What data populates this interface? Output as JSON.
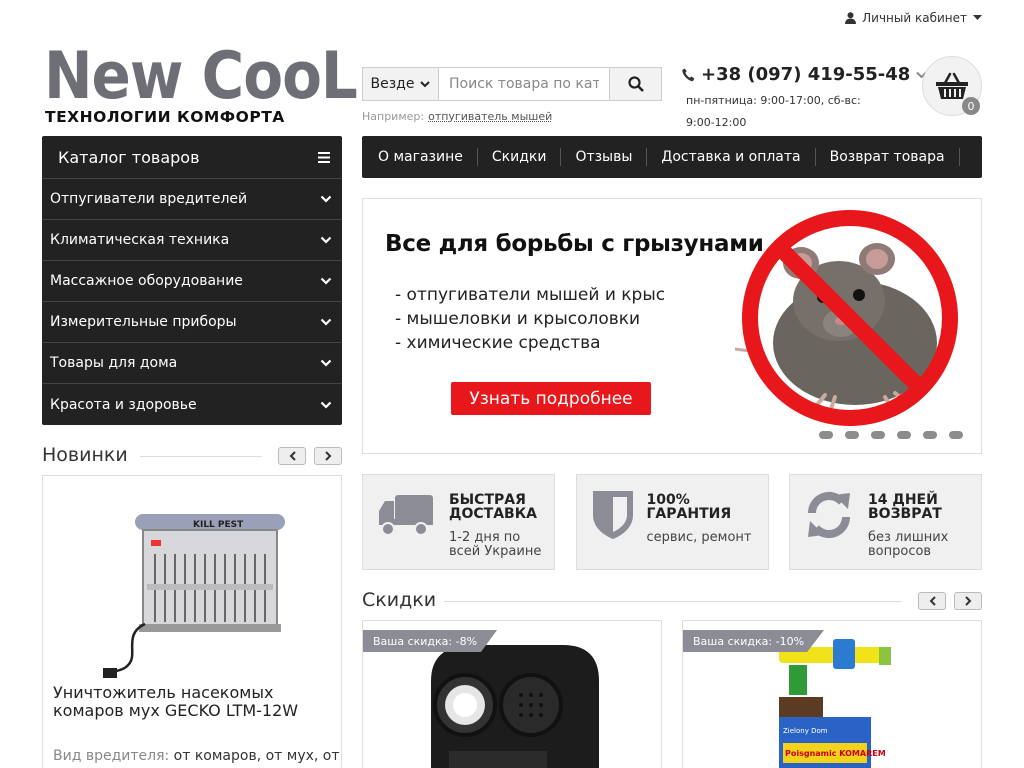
{
  "topbar": {
    "account_label": "Личный кабинет"
  },
  "logo": {
    "main": "New CooL",
    "sub": "ТЕХНОЛОГИИ КОМФОРТА"
  },
  "search": {
    "scope": "Везде",
    "placeholder": "Поиск товара по каталогу",
    "hint_label": "Например:",
    "hint_link": "отпугиватель мышей"
  },
  "contact": {
    "phone": "+38 (097) 419-55-48",
    "hours": "пн-пятница: 9:00-17:00, сб-вс: 9:00-12:00"
  },
  "cart": {
    "count": "0"
  },
  "catalog": {
    "title": "Каталог товаров",
    "items": [
      {
        "label": "Отпугиватели вредителей"
      },
      {
        "label": "Климатическая техника"
      },
      {
        "label": "Массажное оборудование"
      },
      {
        "label": "Измерительные приборы"
      },
      {
        "label": "Товары для дома"
      },
      {
        "label": "Красота и здоровье"
      }
    ]
  },
  "nav": {
    "items": [
      {
        "label": "О магазине"
      },
      {
        "label": "Скидки"
      },
      {
        "label": "Отзывы"
      },
      {
        "label": "Доставка и оплата"
      },
      {
        "label": "Возврат товара"
      }
    ]
  },
  "banner": {
    "title": "Все для борьбы с грызунами",
    "lines": [
      "- отпугиватели мышей и крыс",
      "- мышеловки и крысоловки",
      "- химические средства"
    ],
    "button": "Узнать подробнее",
    "dots": 6
  },
  "features": [
    {
      "title": "Быстрая\nдоставка",
      "text": "1-2 дня по\nвсей Украине",
      "icon": "truck-icon"
    },
    {
      "title": "100%\nгарантия",
      "text": "сервис, ремонт",
      "icon": "shield-icon"
    },
    {
      "title": "14 дней\nвозврат",
      "text": "без лишних\nвопросов",
      "icon": "refresh-icon"
    }
  ],
  "new_section": {
    "title": "Новинки",
    "product": {
      "name": "Уничтожитель насекомых комаров мух GECKO LTM-12W",
      "device_label": "KILL PEST",
      "attr_label": "Вид вредителя:",
      "attr_value": "от комаров, от мух, от"
    }
  },
  "discount_section": {
    "title": "Скидки",
    "products": [
      {
        "tag": "Ваша скидка: -8%"
      },
      {
        "tag": "Ваша скидка: -10%",
        "brand": "Zielony Dom",
        "label": "Poisgnamic KOMAREM"
      }
    ]
  },
  "colors": {
    "dark": "#222222",
    "accent_red": "#e8171b",
    "logo_gray": "#6e6e76"
  }
}
